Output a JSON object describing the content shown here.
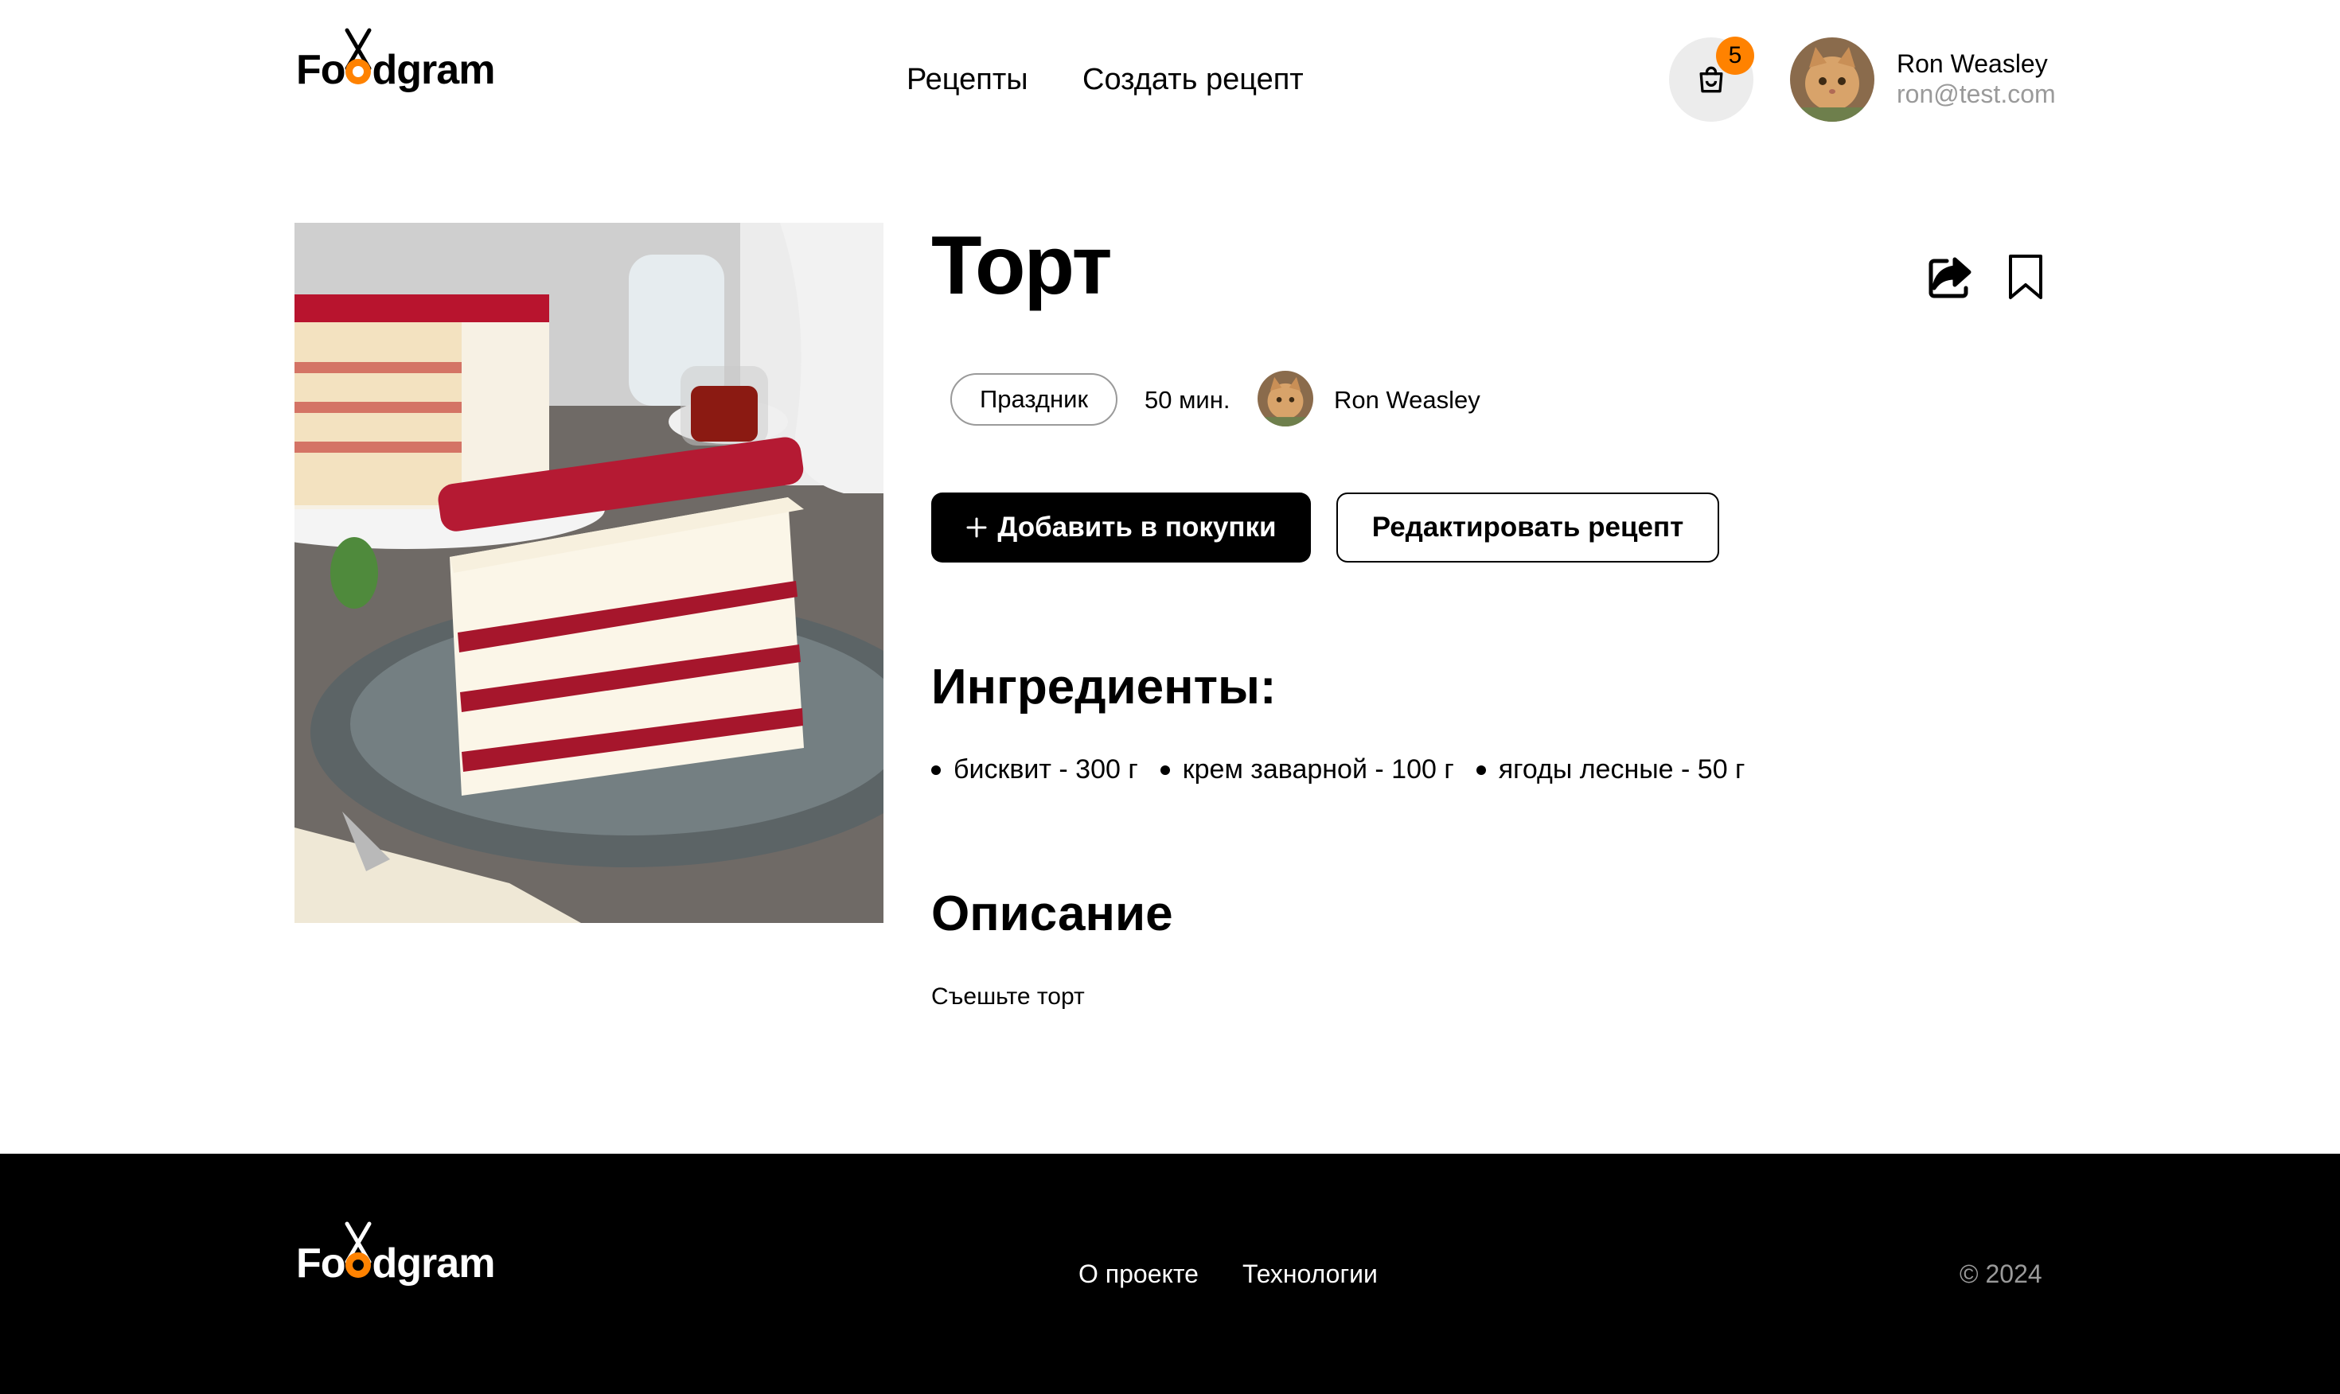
{
  "header": {
    "logo": {
      "before": "Fo",
      "after": "dgram"
    },
    "nav": [
      {
        "label": "Рецепты"
      },
      {
        "label": "Создать рецепт"
      }
    ],
    "cart_count": "5",
    "user": {
      "name": "Ron Weasley",
      "email": "ron@test.com"
    }
  },
  "recipe": {
    "title": "Торт",
    "tag": "Праздник",
    "time": "50 мин.",
    "author": "Ron Weasley",
    "add_to_cart_label": "Добавить в покупки",
    "edit_label": "Редактировать рецепт",
    "ingredients_title": "Ингредиенты:",
    "ingredients": [
      {
        "text": "бисквит - 300 г"
      },
      {
        "text": "крем заварной - 100 г"
      },
      {
        "text": "ягоды лесные - 50 г"
      }
    ],
    "description_title": "Описание",
    "description": "Съешьте торт"
  },
  "footer": {
    "logo": {
      "before": "Fo",
      "after": "dgram"
    },
    "links": [
      {
        "label": "О проекте"
      },
      {
        "label": "Технологии"
      }
    ],
    "copyright": "© 2024"
  },
  "colors": {
    "accent": "#ff8200",
    "muted": "#9a9a9a",
    "footer_bg": "#000000"
  },
  "icons": [
    "cart-icon",
    "share-icon",
    "bookmark-icon",
    "plus-icon"
  ]
}
